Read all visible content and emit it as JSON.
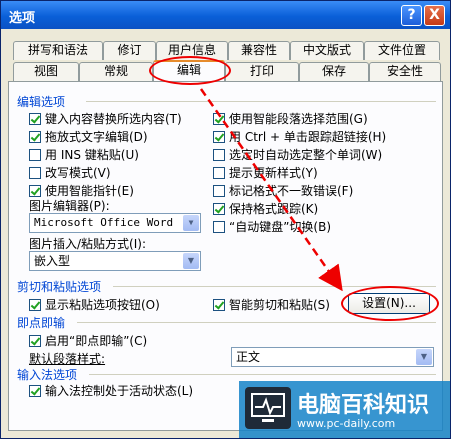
{
  "window": {
    "title": "选项",
    "help": "?",
    "close": "X"
  },
  "tabs_row1": [
    "拼写和语法",
    "修订",
    "用户信息",
    "兼容性",
    "中文版式",
    "文件位置"
  ],
  "tabs_row2": [
    "视图",
    "常规",
    "编辑",
    "打印",
    "保存",
    "安全性"
  ],
  "sections": {
    "edit": "编辑选项",
    "cut": "剪切和粘贴选项",
    "click": "即点即输",
    "ime": "输入法选项"
  },
  "edit_left": [
    {
      "label": "键入内容替换所选内容(T)",
      "checked": true
    },
    {
      "label": "拖放式文字编辑(D)",
      "checked": true
    },
    {
      "label": "用 INS 键粘贴(U)",
      "checked": false
    },
    {
      "label": "改写模式(V)",
      "checked": false
    },
    {
      "label": "使用智能指针(E)",
      "checked": true
    }
  ],
  "edit_right": [
    {
      "label": "使用智能段落选择范围(G)",
      "checked": true
    },
    {
      "label": "用 Ctrl + 单击跟踪超链接(H)",
      "checked": true
    },
    {
      "label": "选定时自动选定整个单词(W)",
      "checked": false
    },
    {
      "label": "提示更新样式(Y)",
      "checked": false
    },
    {
      "label": "标记格式不一致错误(F)",
      "checked": false
    },
    {
      "label": "保持格式跟踪(K)",
      "checked": true
    },
    {
      "label": "“自动键盘”切换(B)",
      "checked": false
    }
  ],
  "picture_editor": {
    "label": "图片编辑器(P):",
    "value": "Microsoft Office Word"
  },
  "picture_insert": {
    "label": "图片插入/粘贴方式(I):",
    "value": "嵌入型"
  },
  "cut": {
    "show_paste": {
      "label": "显示粘贴选项按钮(O)",
      "checked": true
    },
    "smart_cut": {
      "label": "智能剪切和粘贴(S)",
      "checked": true
    },
    "settings": "设置(N)..."
  },
  "click_type": {
    "enable": {
      "label": "启用“即点即输”(C)",
      "checked": true
    },
    "style_label": "默认段落样式:",
    "style_value": "正文"
  },
  "ime": {
    "label": "输入法控制处于活动状态(L)",
    "checked": true
  },
  "watermark": {
    "brand": "电脑百科知识",
    "url": "www.pc-daily.com"
  },
  "colors": {
    "titlebar": "#0a5fd8",
    "annotation": "#e00000",
    "group_text": "#0046d5"
  }
}
